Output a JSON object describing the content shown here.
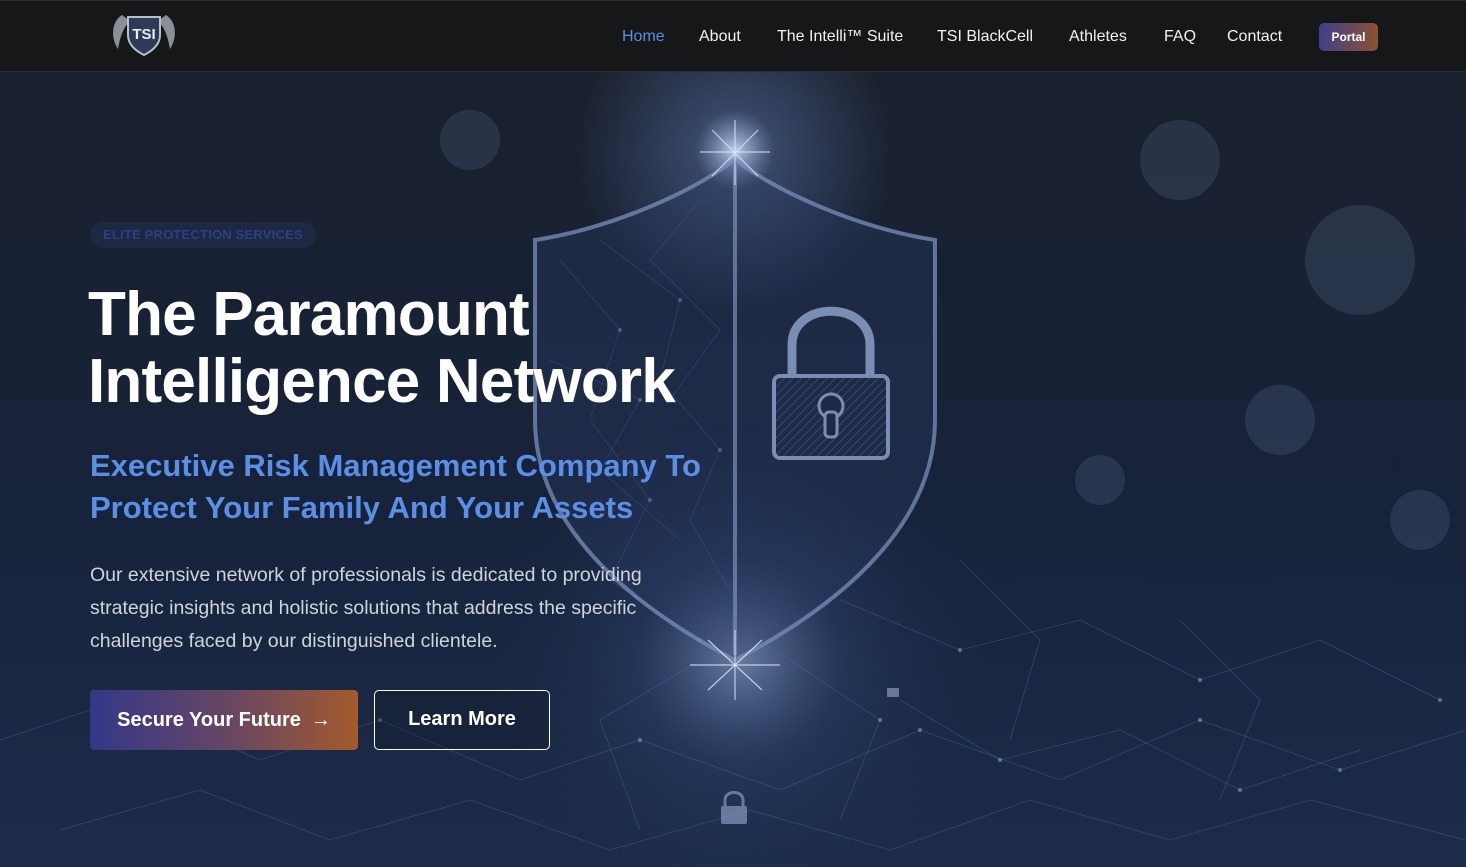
{
  "brand": {
    "logo_text": "TSI"
  },
  "nav": {
    "items": [
      {
        "label": "Home",
        "active": true
      },
      {
        "label": "About"
      },
      {
        "label": "The Intelli™ Suite"
      },
      {
        "label": "TSI BlackCell"
      },
      {
        "label": "Athletes"
      },
      {
        "label": "FAQ"
      },
      {
        "label": "Contact"
      }
    ],
    "portal_label": "Portal"
  },
  "hero": {
    "eyebrow": "ELITE PROTECTION SERVICES",
    "headline_line1": "The Paramount",
    "headline_line2": "Intelligence Network",
    "subheadline": "Executive Risk Management Company To Protect Your Family And Your Assets",
    "body": "Our extensive network of professionals is dedicated to providing strategic insights and holistic solutions that address the specific challenges faced by our distinguished clientele.",
    "primary_cta": "Secure Your Future",
    "primary_cta_icon": "arrow-right-icon",
    "secondary_cta": "Learn More"
  },
  "colors": {
    "accent_blue": "#5b8fe6",
    "nav_bg": "#161718",
    "hero_bg": "#141a26",
    "gradient_start": "#34378a",
    "gradient_end": "#a35a2c"
  }
}
